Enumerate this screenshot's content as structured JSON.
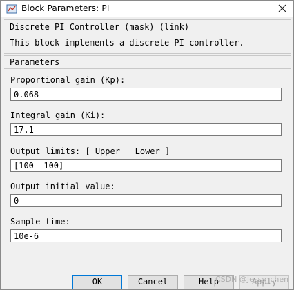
{
  "window": {
    "title": "Block Parameters: PI",
    "icons": {
      "app": "simulink-block-icon",
      "close": "close-icon"
    }
  },
  "description": {
    "title": "Discrete PI Controller (mask) (link)",
    "text": "This block implements a discrete PI controller."
  },
  "parameters": {
    "title": "Parameters",
    "fields": [
      {
        "label": "Proportional gain (Kp):",
        "value": "0.068"
      },
      {
        "label": "Integral gain (Ki):",
        "value": "17.1"
      },
      {
        "label": "Output limits: [ Upper   Lower ]",
        "value": "[100 -100]"
      },
      {
        "label": "Output initial value:",
        "value": "0"
      },
      {
        "label": "Sample time:",
        "value": "10e-6"
      }
    ]
  },
  "buttons": {
    "ok": "OK",
    "cancel": "Cancel",
    "help": "Help",
    "apply": "Apply"
  },
  "watermark": "CSDN @Jessy_chen",
  "colors": {
    "window_bg": "#f0f0f0",
    "titlebar_bg": "#ffffff",
    "ok_border": "#0078d7"
  }
}
